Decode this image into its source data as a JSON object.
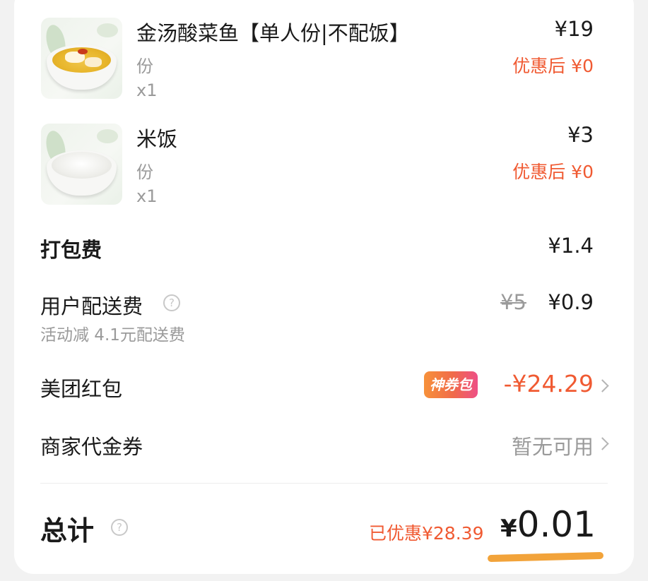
{
  "items": [
    {
      "name": "金汤酸菜鱼【单人份|不配饭】",
      "spec": "份",
      "qty": "x1",
      "price": "¥19",
      "discount": "优惠后 ¥0",
      "image_icon": "fish-soup-dish"
    },
    {
      "name": "米饭",
      "spec": "份",
      "qty": "x1",
      "price": "¥3",
      "discount": "优惠后 ¥0",
      "image_icon": "rice-bowl"
    }
  ],
  "packing_fee": {
    "label": "打包费",
    "value": "¥1.4"
  },
  "delivery_fee": {
    "label": "用户配送费",
    "note": "活动减 4.1元配送费",
    "original": "¥5",
    "value": "¥0.9",
    "help_glyph": "?"
  },
  "red_packet": {
    "label": "美团红包",
    "badge": "神券包",
    "value": "-¥24.29"
  },
  "merchant_coupon": {
    "label": "商家代金券",
    "value": "暂无可用"
  },
  "total": {
    "label": "总计",
    "help_glyph": "?",
    "saved": "已优惠¥28.39",
    "currency": "¥",
    "amount": "0.01"
  },
  "colors": {
    "accent_red": "#f05a32",
    "highlight_orange": "#f2a33a",
    "muted_text": "#9a9a9a"
  }
}
